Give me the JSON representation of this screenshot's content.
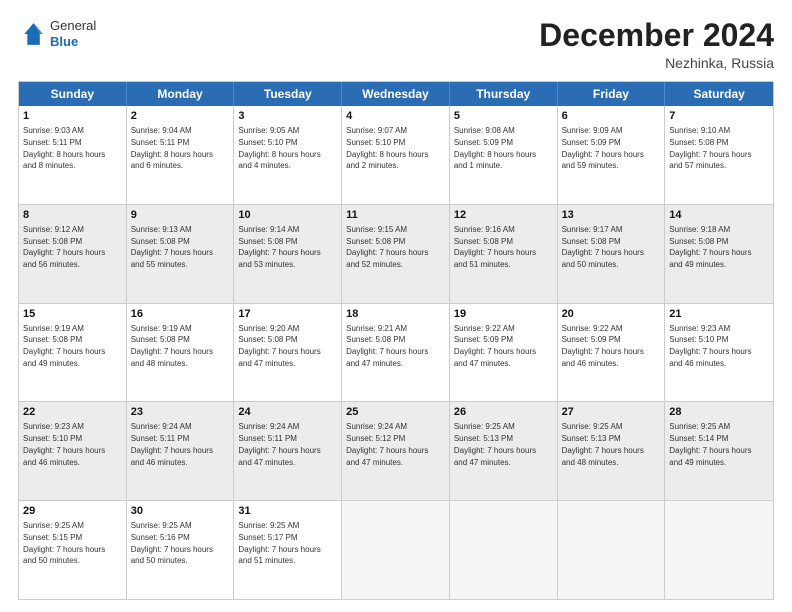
{
  "logo": {
    "general": "General",
    "blue": "Blue"
  },
  "header": {
    "month": "December 2024",
    "location": "Nezhinka, Russia"
  },
  "days": [
    "Sunday",
    "Monday",
    "Tuesday",
    "Wednesday",
    "Thursday",
    "Friday",
    "Saturday"
  ],
  "weeks": [
    [
      {
        "day": "1",
        "rise": "9:03 AM",
        "set": "5:11 PM",
        "daylight": "8 hours and 8 minutes."
      },
      {
        "day": "2",
        "rise": "9:04 AM",
        "set": "5:11 PM",
        "daylight": "8 hours and 6 minutes."
      },
      {
        "day": "3",
        "rise": "9:05 AM",
        "set": "5:10 PM",
        "daylight": "8 hours and 4 minutes."
      },
      {
        "day": "4",
        "rise": "9:07 AM",
        "set": "5:10 PM",
        "daylight": "8 hours and 2 minutes."
      },
      {
        "day": "5",
        "rise": "9:08 AM",
        "set": "5:09 PM",
        "daylight": "8 hours and 1 minute."
      },
      {
        "day": "6",
        "rise": "9:09 AM",
        "set": "5:09 PM",
        "daylight": "7 hours and 59 minutes."
      },
      {
        "day": "7",
        "rise": "9:10 AM",
        "set": "5:08 PM",
        "daylight": "7 hours and 57 minutes."
      }
    ],
    [
      {
        "day": "8",
        "rise": "9:12 AM",
        "set": "5:08 PM",
        "daylight": "7 hours and 56 minutes."
      },
      {
        "day": "9",
        "rise": "9:13 AM",
        "set": "5:08 PM",
        "daylight": "7 hours and 55 minutes."
      },
      {
        "day": "10",
        "rise": "9:14 AM",
        "set": "5:08 PM",
        "daylight": "7 hours and 53 minutes."
      },
      {
        "day": "11",
        "rise": "9:15 AM",
        "set": "5:08 PM",
        "daylight": "7 hours and 52 minutes."
      },
      {
        "day": "12",
        "rise": "9:16 AM",
        "set": "5:08 PM",
        "daylight": "7 hours and 51 minutes."
      },
      {
        "day": "13",
        "rise": "9:17 AM",
        "set": "5:08 PM",
        "daylight": "7 hours and 50 minutes."
      },
      {
        "day": "14",
        "rise": "9:18 AM",
        "set": "5:08 PM",
        "daylight": "7 hours and 49 minutes."
      }
    ],
    [
      {
        "day": "15",
        "rise": "9:19 AM",
        "set": "5:08 PM",
        "daylight": "7 hours and 49 minutes."
      },
      {
        "day": "16",
        "rise": "9:19 AM",
        "set": "5:08 PM",
        "daylight": "7 hours and 48 minutes."
      },
      {
        "day": "17",
        "rise": "9:20 AM",
        "set": "5:08 PM",
        "daylight": "7 hours and 47 minutes."
      },
      {
        "day": "18",
        "rise": "9:21 AM",
        "set": "5:08 PM",
        "daylight": "7 hours and 47 minutes."
      },
      {
        "day": "19",
        "rise": "9:22 AM",
        "set": "5:09 PM",
        "daylight": "7 hours and 47 minutes."
      },
      {
        "day": "20",
        "rise": "9:22 AM",
        "set": "5:09 PM",
        "daylight": "7 hours and 46 minutes."
      },
      {
        "day": "21",
        "rise": "9:23 AM",
        "set": "5:10 PM",
        "daylight": "7 hours and 46 minutes."
      }
    ],
    [
      {
        "day": "22",
        "rise": "9:23 AM",
        "set": "5:10 PM",
        "daylight": "7 hours and 46 minutes."
      },
      {
        "day": "23",
        "rise": "9:24 AM",
        "set": "5:11 PM",
        "daylight": "7 hours and 46 minutes."
      },
      {
        "day": "24",
        "rise": "9:24 AM",
        "set": "5:11 PM",
        "daylight": "7 hours and 47 minutes."
      },
      {
        "day": "25",
        "rise": "9:24 AM",
        "set": "5:12 PM",
        "daylight": "7 hours and 47 minutes."
      },
      {
        "day": "26",
        "rise": "9:25 AM",
        "set": "5:13 PM",
        "daylight": "7 hours and 47 minutes."
      },
      {
        "day": "27",
        "rise": "9:25 AM",
        "set": "5:13 PM",
        "daylight": "7 hours and 48 minutes."
      },
      {
        "day": "28",
        "rise": "9:25 AM",
        "set": "5:14 PM",
        "daylight": "7 hours and 49 minutes."
      }
    ],
    [
      {
        "day": "29",
        "rise": "9:25 AM",
        "set": "5:15 PM",
        "daylight": "7 hours and 50 minutes."
      },
      {
        "day": "30",
        "rise": "9:25 AM",
        "set": "5:16 PM",
        "daylight": "7 hours and 50 minutes."
      },
      {
        "day": "31",
        "rise": "9:25 AM",
        "set": "5:17 PM",
        "daylight": "7 hours and 51 minutes."
      },
      null,
      null,
      null,
      null
    ]
  ]
}
